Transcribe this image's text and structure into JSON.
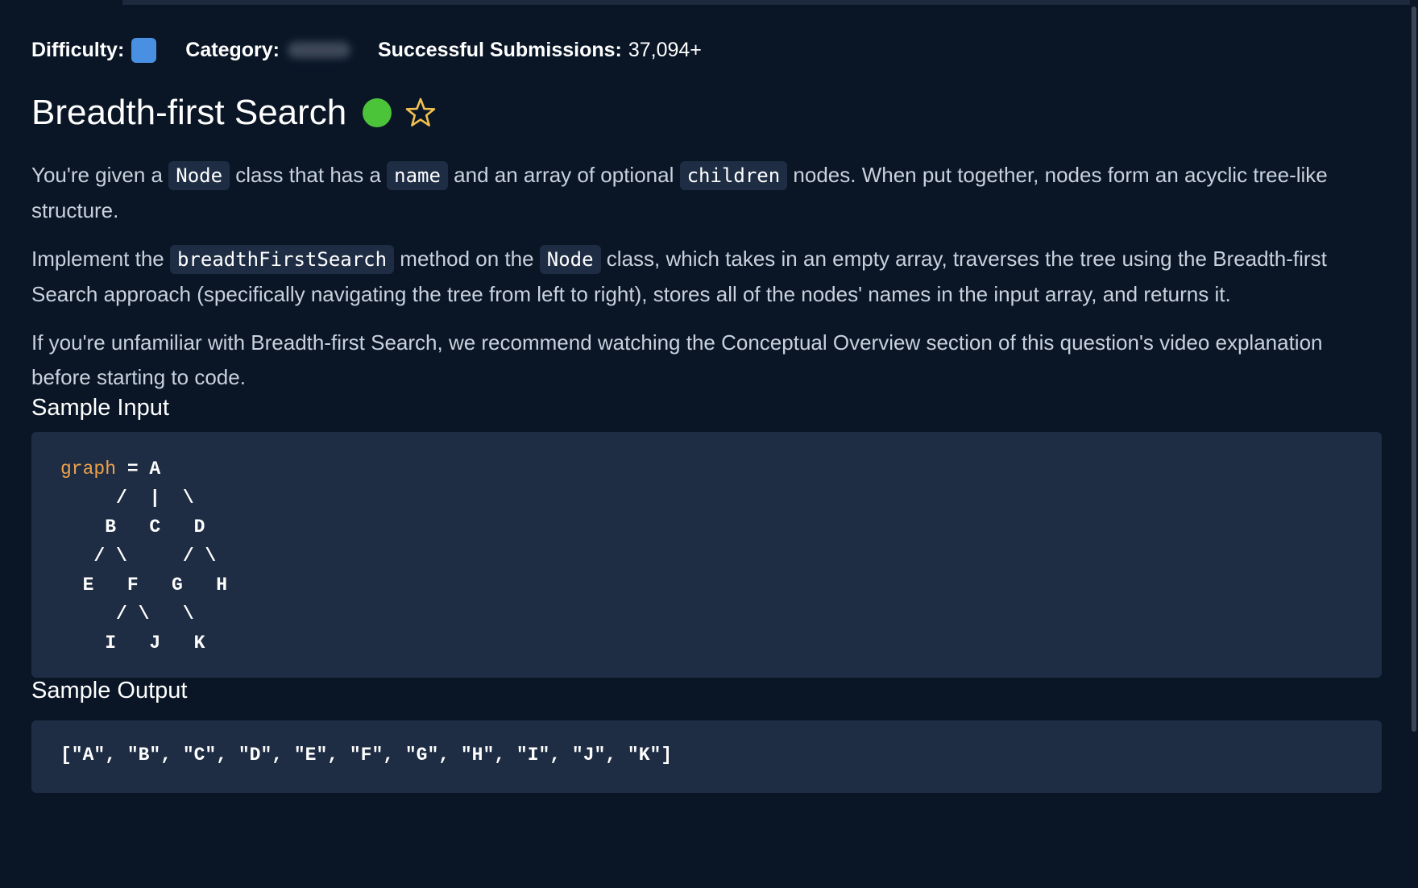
{
  "meta": {
    "difficulty_label": "Difficulty:",
    "category_label": "Category:",
    "submissions_label": "Successful Submissions:",
    "submissions_value": "37,094+",
    "difficulty_color": "#4a90e2"
  },
  "question": {
    "title": "Breadth-first Search",
    "status_color": "#4cc43a",
    "status_icon": "completed-dot-icon",
    "favorite_icon": "star-outline-icon"
  },
  "description": {
    "p1": {
      "t1": "You're given a ",
      "c1": "Node",
      "t2": " class that has a ",
      "c2": "name",
      "t3": " and an array of optional ",
      "c3": "children",
      "t4": " nodes. When put together, nodes form an acyclic tree-like structure."
    },
    "p2": {
      "t1": "Implement the ",
      "c1": "breadthFirstSearch",
      "t2": " method on the ",
      "c2": "Node",
      "t3": " class, which takes in an empty array, traverses the tree using the Breadth-first Search approach (specifically navigating the tree from left to right), stores all of the nodes' names in the input array, and returns it."
    },
    "p3": "If you're unfamiliar with Breadth-first Search, we recommend watching the Conceptual Overview section of this question's video explanation before starting to code."
  },
  "sample_input": {
    "heading": "Sample Input",
    "var_name": "graph",
    "first_line_rest": " = A",
    "tree_lines": "     /  |  \\\n    B   C   D\n   / \\     / \\\n  E   F   G   H\n     / \\   \\\n    I   J   K"
  },
  "sample_output": {
    "heading": "Sample Output",
    "value": "[\"A\", \"B\", \"C\", \"D\", \"E\", \"F\", \"G\", \"H\", \"I\", \"J\", \"K\"]"
  }
}
